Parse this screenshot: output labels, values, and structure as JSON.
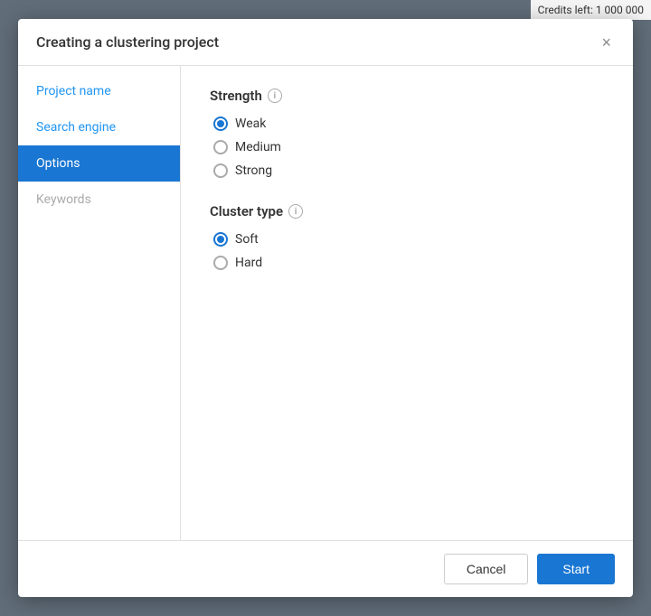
{
  "top_bar": {
    "credits": "Credits left: 1 000 000"
  },
  "modal": {
    "title": "Creating a clustering project",
    "close_label": "×"
  },
  "sidebar": {
    "items": [
      {
        "id": "project-name",
        "label": "Project name",
        "state": "link"
      },
      {
        "id": "search-engine",
        "label": "Search engine",
        "state": "link"
      },
      {
        "id": "options",
        "label": "Options",
        "state": "active"
      },
      {
        "id": "keywords",
        "label": "Keywords",
        "state": "disabled"
      }
    ]
  },
  "content": {
    "strength_section": {
      "title": "Strength",
      "info_tooltip": "i",
      "options": [
        {
          "id": "weak",
          "label": "Weak",
          "checked": true
        },
        {
          "id": "medium",
          "label": "Medium",
          "checked": false
        },
        {
          "id": "strong",
          "label": "Strong",
          "checked": false
        }
      ]
    },
    "cluster_type_section": {
      "title": "Cluster type",
      "info_tooltip": "i",
      "options": [
        {
          "id": "soft",
          "label": "Soft",
          "checked": true
        },
        {
          "id": "hard",
          "label": "Hard",
          "checked": false
        }
      ]
    }
  },
  "footer": {
    "cancel_label": "Cancel",
    "start_label": "Start"
  }
}
